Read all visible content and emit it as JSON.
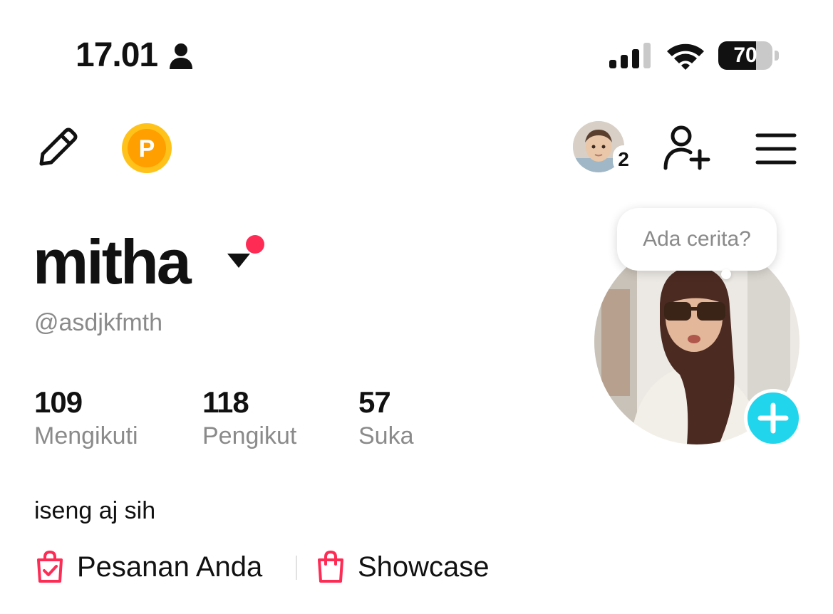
{
  "status_bar": {
    "time": "17.01",
    "battery_level": 70,
    "battery_text": "70"
  },
  "toolbar": {
    "coin_letter": "P",
    "account_count": "2"
  },
  "profile": {
    "username": "mitha",
    "handle": "@asdjkfmth",
    "bio": "iseng aj sih",
    "story_prompt": "Ada cerita?"
  },
  "stats": [
    {
      "value": "109",
      "label": "Mengikuti"
    },
    {
      "value": "118",
      "label": "Pengikut"
    },
    {
      "value": "57",
      "label": "Suka"
    }
  ],
  "links": [
    {
      "label": "Pesanan Anda",
      "icon": "shopping-bag-check-icon"
    },
    {
      "label": "Showcase",
      "icon": "shopping-bag-icon"
    }
  ],
  "colors": {
    "accent_red": "#fe2c55",
    "add_button_cyan": "#20d5ec",
    "coin_orange": "#ff9f00",
    "muted_text": "#8a8a8a"
  }
}
